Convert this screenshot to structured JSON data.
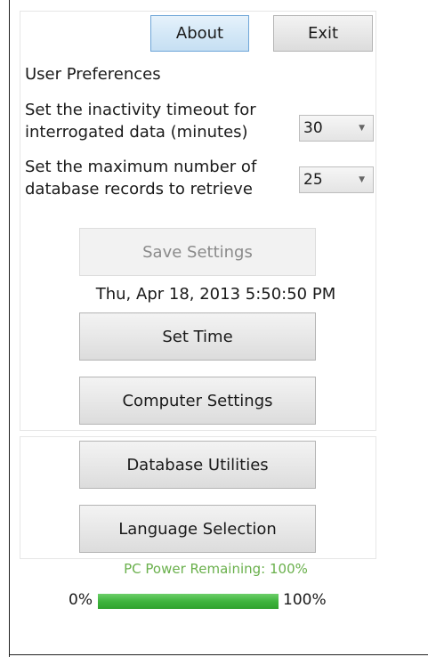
{
  "header": {
    "about_label": "About",
    "exit_label": "Exit"
  },
  "preferences": {
    "title": "User Preferences",
    "timeout_label_line1": "Set the inactivity timeout for",
    "timeout_label_line2": "interrogated data (minutes)",
    "timeout_value": "30",
    "max_records_label_line1": "Set the maximum number of",
    "max_records_label_line2": "database records to retrieve",
    "max_records_value": "25",
    "save_label": "Save Settings"
  },
  "clock": {
    "datetime": "Thu, Apr 18, 2013 5:50:50 PM"
  },
  "actions": {
    "set_time_label": "Set Time",
    "computer_settings_label": "Computer Settings",
    "database_utilities_label": "Database Utilities",
    "language_selection_label": "Language Selection"
  },
  "power": {
    "text": "PC Power Remaining: 100%",
    "min_label": "0%",
    "max_label": "100%",
    "level": 1.0,
    "color": "#3fb43e"
  }
}
